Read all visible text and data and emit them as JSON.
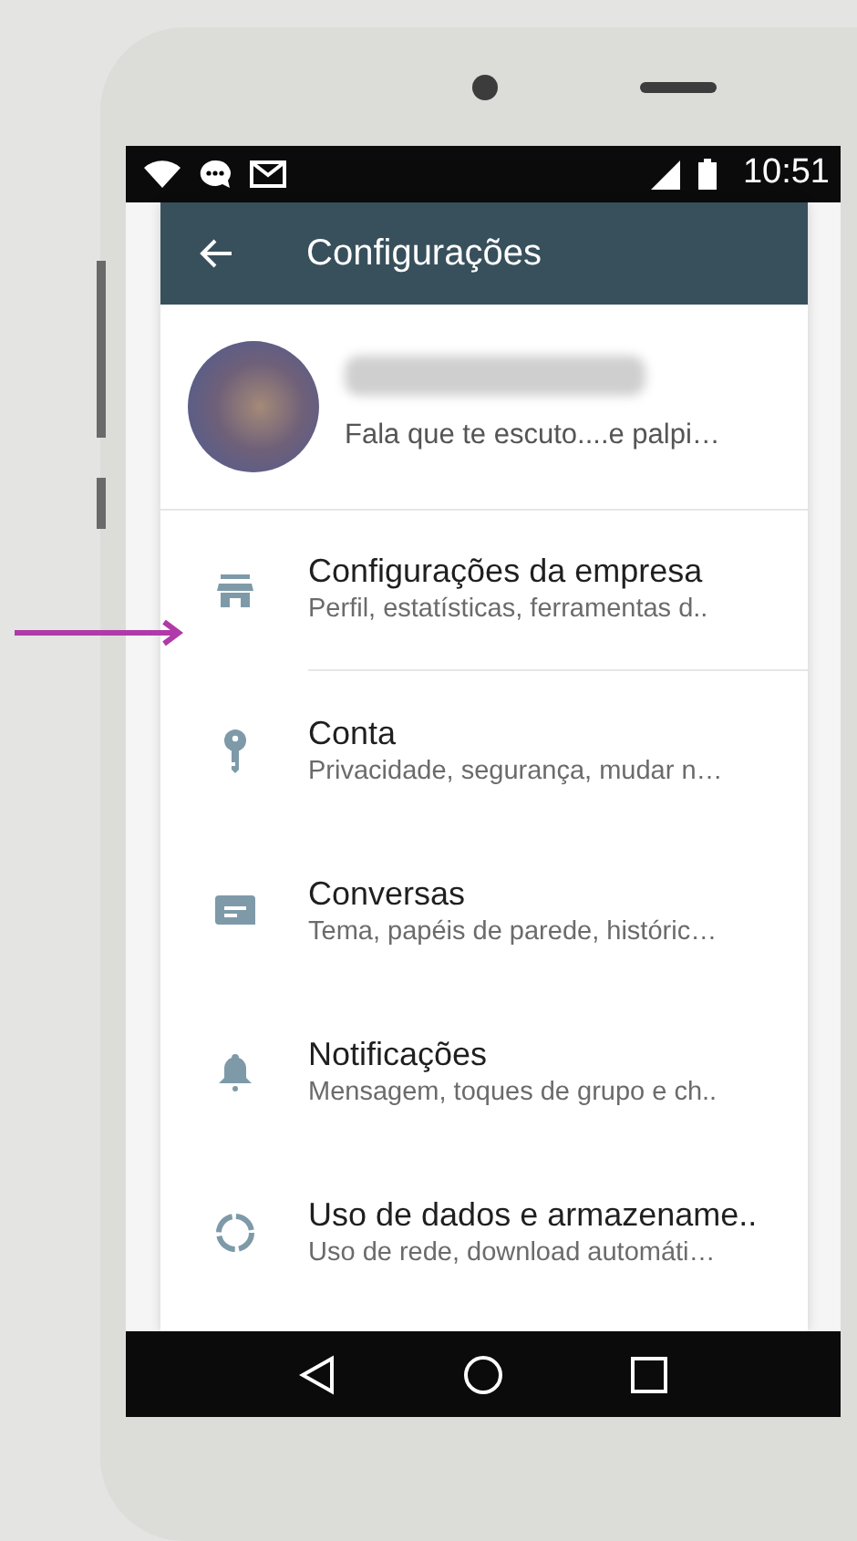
{
  "status_bar": {
    "time": "10:51"
  },
  "app_bar": {
    "title": "Configurações"
  },
  "profile": {
    "status": "Fala que te escuto....e palpi…"
  },
  "items": [
    {
      "kind": "store",
      "title": "Configurações da empresa",
      "subtitle": "Perfil, estatísticas, ferramentas d..",
      "pointed": true,
      "divider": true
    },
    {
      "kind": "key",
      "title": "Conta",
      "subtitle": "Privacidade, segurança, mudar n…",
      "pointed": false,
      "divider": false
    },
    {
      "kind": "chat",
      "title": "Conversas",
      "subtitle": "Tema, papéis de parede, históric…",
      "pointed": false,
      "divider": false
    },
    {
      "kind": "bell",
      "title": "Notificações",
      "subtitle": "Mensagem, toques de grupo e ch..",
      "pointed": false,
      "divider": false
    },
    {
      "kind": "data",
      "title": "Uso de dados e armazename..",
      "subtitle": "Uso de rede, download automáti…",
      "pointed": false,
      "divider": false
    }
  ]
}
